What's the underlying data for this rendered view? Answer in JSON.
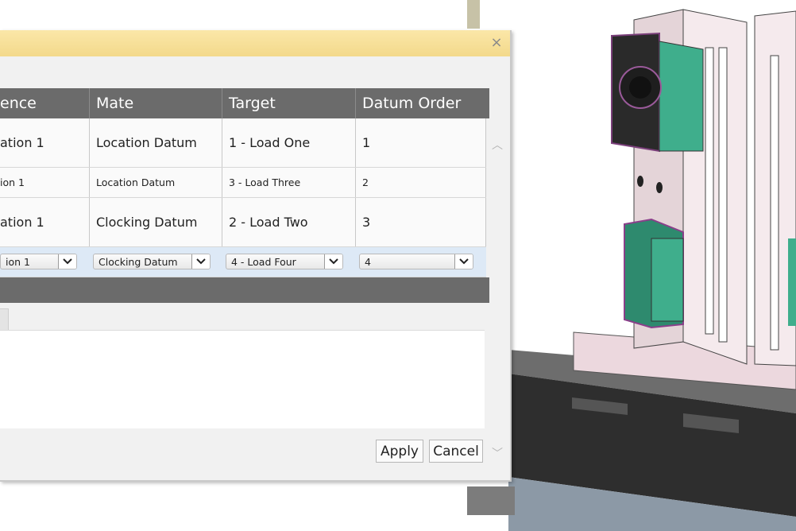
{
  "dialog": {
    "close_glyph": "×",
    "columns": [
      "ence",
      "Mate",
      "Target",
      "Datum Order"
    ],
    "rows": [
      {
        "reference": "ation 1",
        "mate": "Location Datum",
        "target": "1 - Load One",
        "order": "1",
        "size": "big"
      },
      {
        "reference": "ion 1",
        "mate": "Location Datum",
        "target": "3 - Load Three",
        "order": "2",
        "size": "small"
      },
      {
        "reference": "ation 1",
        "mate": "Clocking Datum",
        "target": "2 - Load Two",
        "order": "3",
        "size": "big"
      }
    ],
    "edit_row": {
      "reference": "ion 1",
      "mate": "Clocking Datum",
      "target": "4 - Load Four",
      "order": "4"
    },
    "buttons": {
      "apply": "Apply",
      "cancel": "Cancel"
    },
    "scroll_up_glyph": "︿",
    "scroll_down_glyph": "﹀"
  },
  "colors": {
    "title_bar": "#f3d98b",
    "header": "#6b6b6b",
    "selected_row": "#dde9f6",
    "part_green": "#3fae8c",
    "fixture_pink": "#ecd8de",
    "base_dark": "#2f2f2f"
  },
  "viewport": {
    "description_icon": "cad-fixture-model"
  }
}
